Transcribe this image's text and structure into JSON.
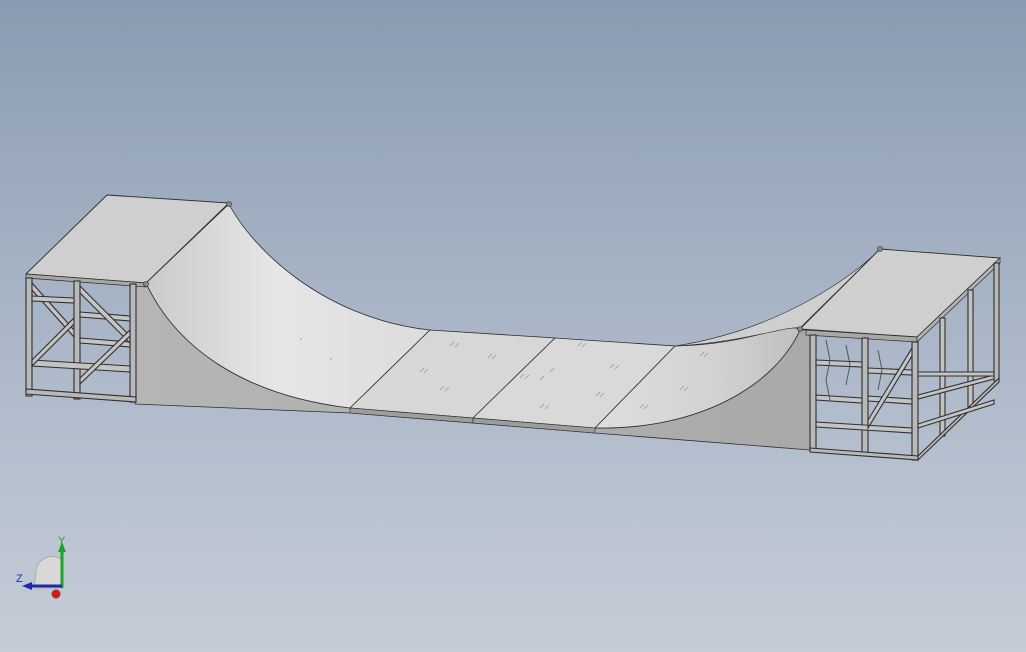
{
  "viewport": {
    "background_top": "#8a9bb1",
    "background_bottom": "#c5ccd7",
    "model": "half-pipe-skate-ramp"
  },
  "triad": {
    "x_label": "",
    "y_label": "Y",
    "z_label": "Z",
    "x_color": "#c8201c",
    "y_color": "#1fa32a",
    "z_color": "#1c2ca8"
  }
}
